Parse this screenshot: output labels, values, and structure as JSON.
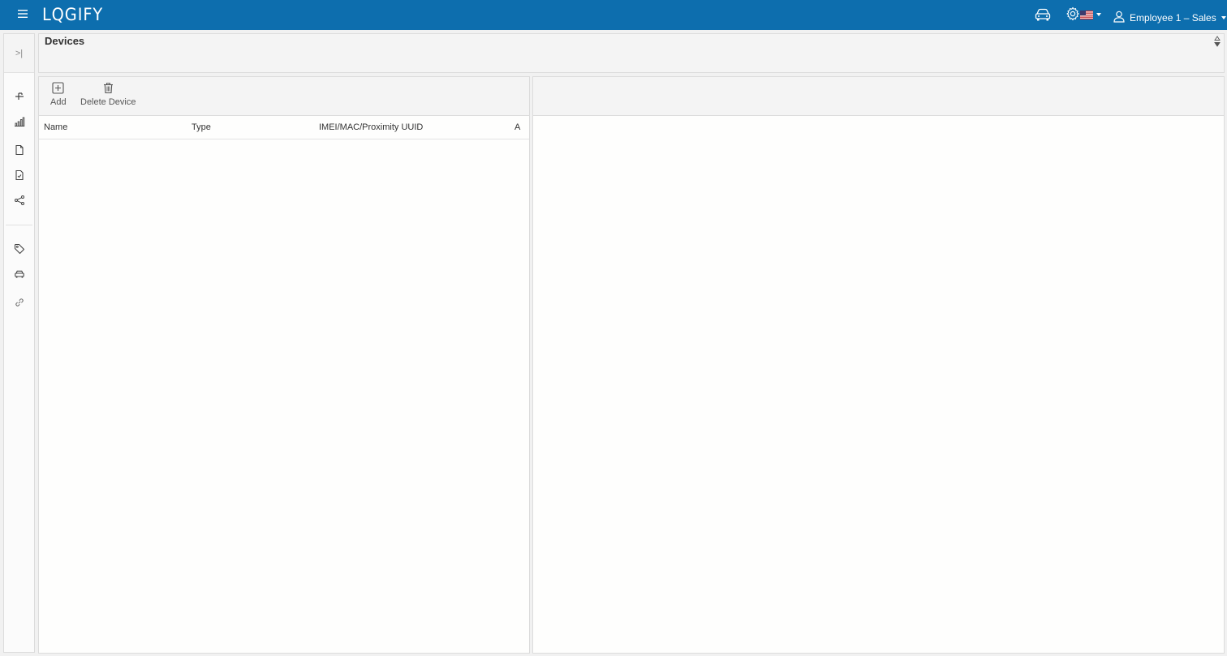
{
  "app": {
    "logo": "LQGIFY",
    "user_name": "Employee 1 – Sales"
  },
  "icons": {
    "menu": "hamburger-icon",
    "vehicle": "car-icon",
    "settings": "gear-icon",
    "language": "us-flag-icon",
    "user": "user-icon",
    "collapse": "expand-sidebar-icon",
    "rail": [
      "route-icon",
      "bar-chart-icon",
      "document-icon",
      "checked-document-icon",
      "share-icon",
      "tag-icon",
      "car-icon",
      "link-icon"
    ]
  },
  "rail": {
    "collapse_label": ">|"
  },
  "page": {
    "title": "Devices"
  },
  "toolbar": {
    "add_label": "Add",
    "delete_label": "Delete Device"
  },
  "table": {
    "columns": [
      "Name",
      "Type",
      "IMEI/MAC/Proximity UUID",
      "A"
    ],
    "rows": []
  },
  "colors": {
    "topbar": "#0d6eae",
    "panel_header": "#f4f4f4",
    "border": "#dcdcdc"
  }
}
